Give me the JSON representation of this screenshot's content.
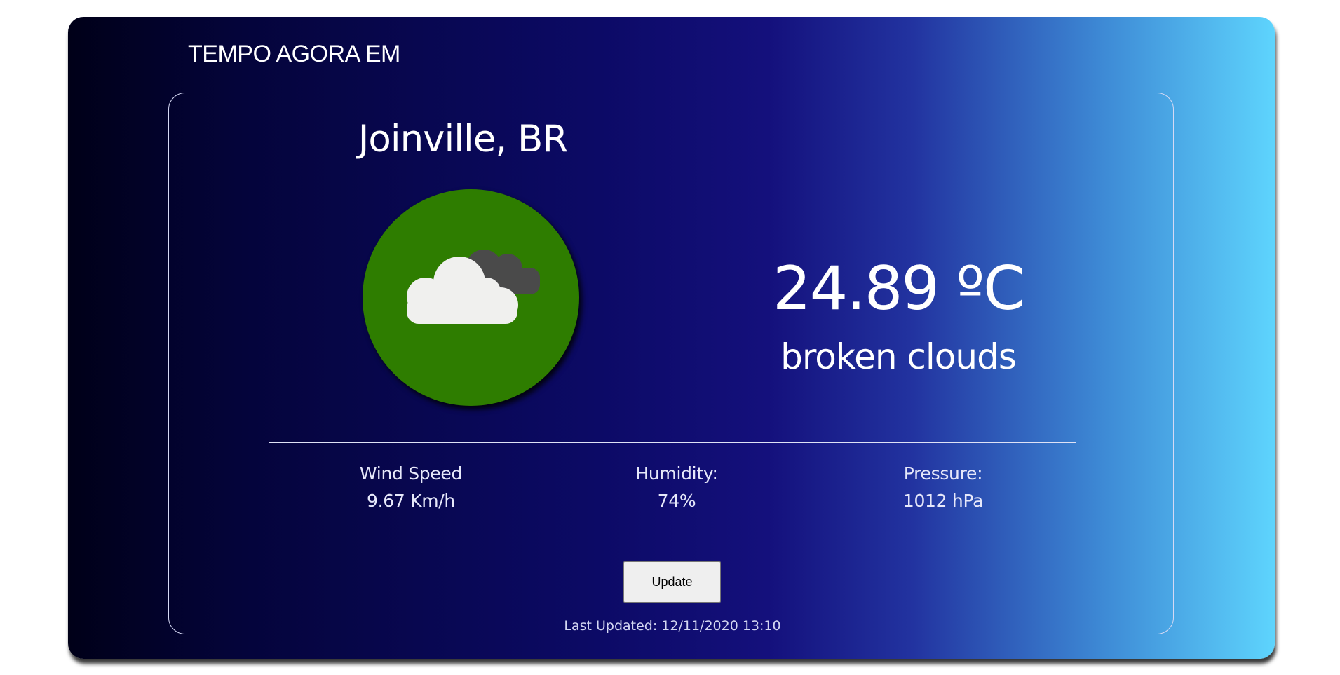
{
  "app": {
    "title": "TEMPO AGORA EM"
  },
  "weather": {
    "city": "Joinville, BR",
    "icon": "broken-clouds-icon",
    "icon_bg_color": "#2e7d00",
    "temperature": "24.89 ºC",
    "description": "broken clouds"
  },
  "stats": {
    "wind": {
      "label": "Wind Speed",
      "value": "9.67 Km/h"
    },
    "humidity": {
      "label": "Humidity:",
      "value": "74%"
    },
    "pressure": {
      "label": "Pressure:",
      "value": "1012 hPa"
    }
  },
  "actions": {
    "update_label": "Update"
  },
  "footer": {
    "last_updated": "Last Updated: 12/11/2020 13:10"
  },
  "theme": {
    "gradient_start": "#000018",
    "gradient_mid": "#14107c",
    "gradient_end": "#5ed4fd"
  }
}
